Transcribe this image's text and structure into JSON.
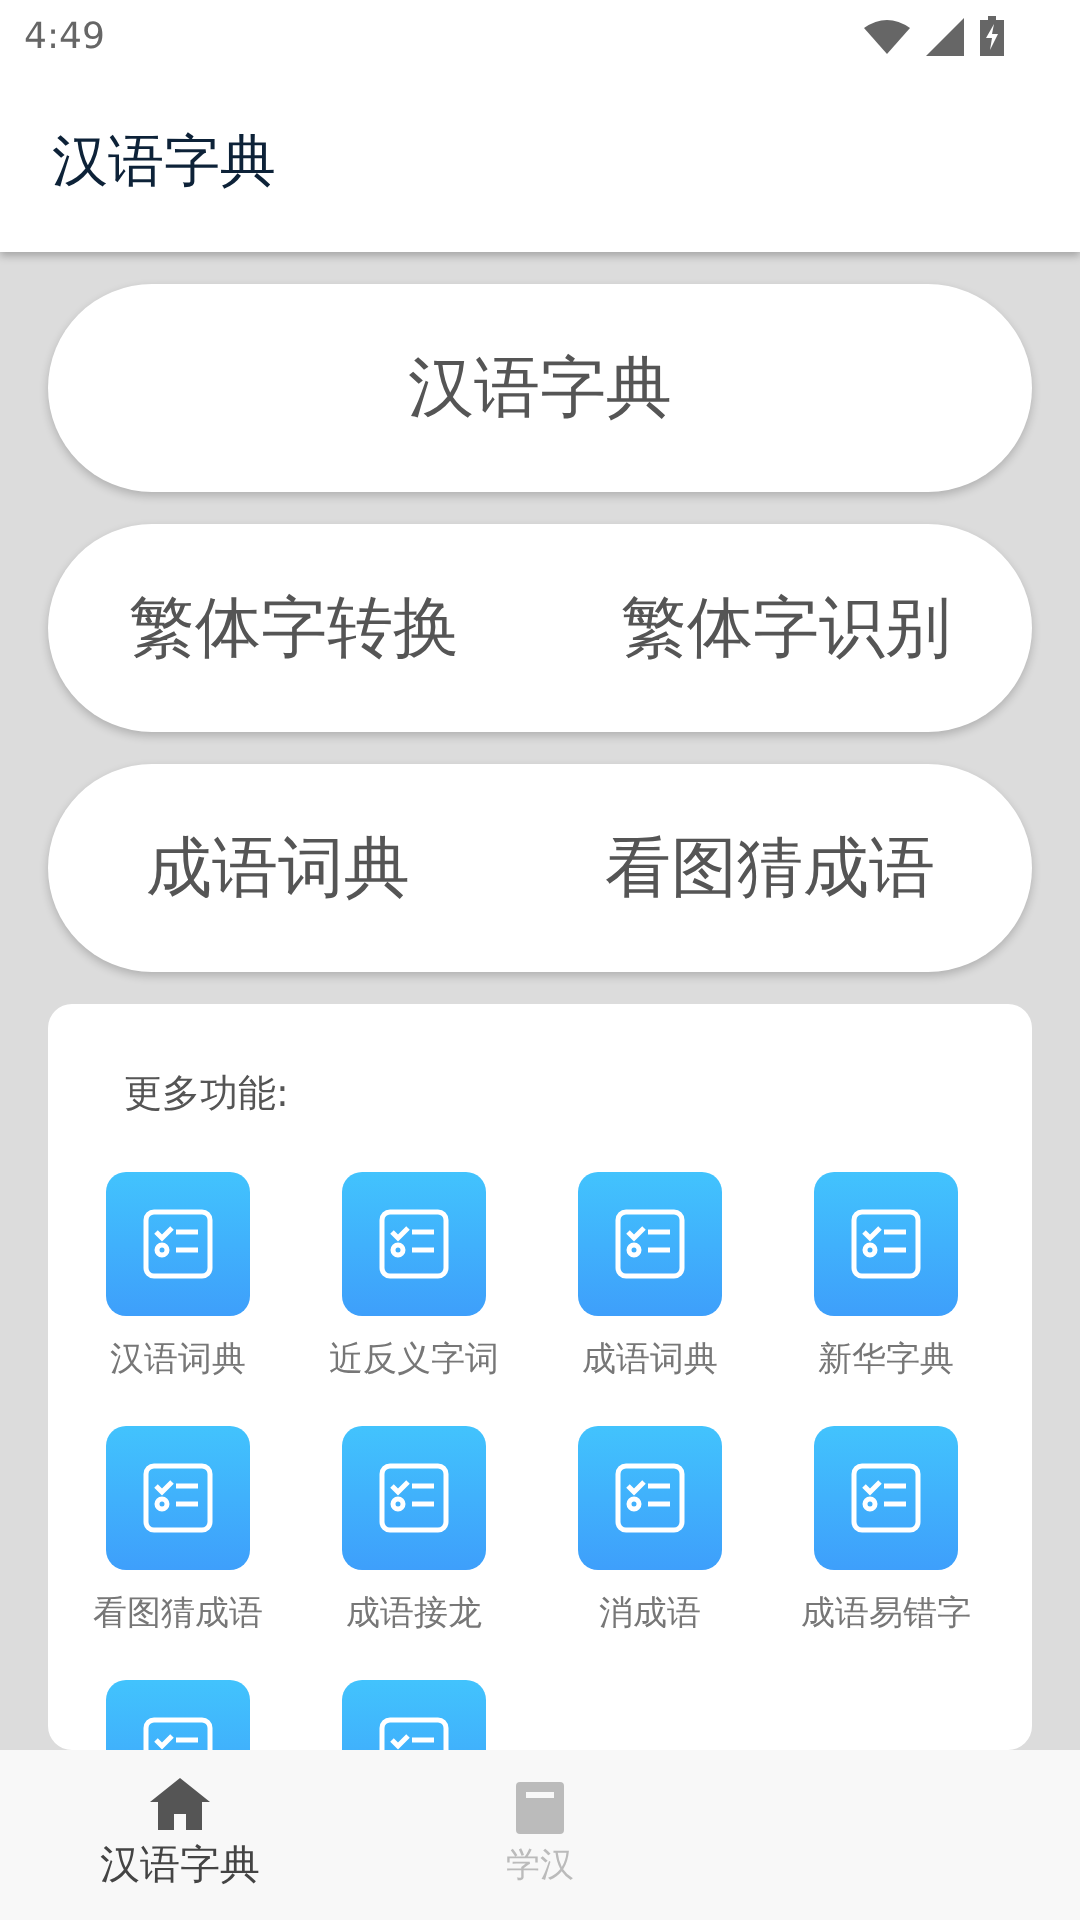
{
  "status_bar": {
    "time": "4:49"
  },
  "app_bar": {
    "title": "汉语字典"
  },
  "big_buttons": [
    {
      "labels": [
        "汉语字典"
      ]
    },
    {
      "labels": [
        "繁体字转换",
        "繁体字识别"
      ]
    },
    {
      "labels": [
        "成语词典",
        "看图猜成语"
      ]
    }
  ],
  "more": {
    "heading": "更多功能:",
    "items": [
      {
        "kind": "tile",
        "label": "汉语词典"
      },
      {
        "kind": "tile",
        "label": "近反义字词"
      },
      {
        "kind": "tile",
        "label": "成语词典"
      },
      {
        "kind": "tile",
        "label": "新华字典"
      },
      {
        "kind": "tile",
        "label": "看图猜成语"
      },
      {
        "kind": "tile",
        "label": "成语接龙"
      },
      {
        "kind": "tile",
        "label": "消成语"
      },
      {
        "kind": "tile",
        "label": "成语易错字"
      },
      {
        "kind": "partial"
      },
      {
        "kind": "partial"
      }
    ]
  },
  "bottom_nav": [
    {
      "label": "汉语字典",
      "selected": true,
      "kind": "home"
    },
    {
      "label": "学汉",
      "selected": false,
      "kind": "book"
    }
  ]
}
